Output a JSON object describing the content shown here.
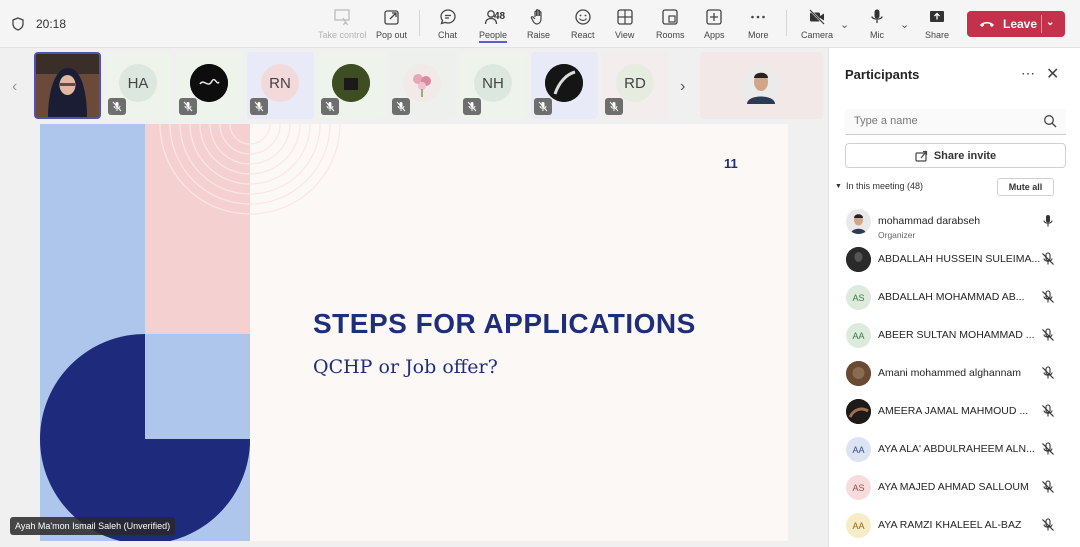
{
  "topbar": {
    "time": "20:18",
    "people_count": "48",
    "buttons": [
      {
        "key": "take_control",
        "label": "Take control"
      },
      {
        "key": "pop_out",
        "label": "Pop out"
      },
      {
        "key": "chat",
        "label": "Chat"
      },
      {
        "key": "people",
        "label": "People"
      },
      {
        "key": "raise",
        "label": "Raise"
      },
      {
        "key": "react",
        "label": "React"
      },
      {
        "key": "view",
        "label": "View"
      },
      {
        "key": "rooms",
        "label": "Rooms"
      },
      {
        "key": "apps",
        "label": "Apps"
      },
      {
        "key": "more",
        "label": "More"
      },
      {
        "key": "camera",
        "label": "Camera"
      },
      {
        "key": "mic",
        "label": "Mic"
      },
      {
        "key": "share",
        "label": "Share"
      }
    ],
    "leave_label": "Leave"
  },
  "strip": {
    "tiles": [
      {
        "initials": "",
        "kind": "video"
      },
      {
        "initials": "HA",
        "kind": "initials"
      },
      {
        "initials": "",
        "kind": "photo"
      },
      {
        "initials": "RN",
        "kind": "initials"
      },
      {
        "initials": "",
        "kind": "photo"
      },
      {
        "initials": "",
        "kind": "photo"
      },
      {
        "initials": "NH",
        "kind": "initials"
      },
      {
        "initials": "",
        "kind": "photo"
      },
      {
        "initials": "RD",
        "kind": "initials"
      }
    ]
  },
  "slide": {
    "number": "11",
    "title": "STEPS FOR APPLICATIONS",
    "subtitle": "QCHP or Job offer?"
  },
  "presenter_tag": "Ayah Ma'mon Ismail Saleh (Unverified)",
  "panel": {
    "title": "Participants",
    "search_placeholder": "Type a name",
    "share_invite": "Share invite",
    "section_label": "In this meeting (48)",
    "mute_all": "Mute all",
    "participants": [
      {
        "name": "mohammad darabseh",
        "role": "Organizer",
        "initials": "",
        "mic": "on"
      },
      {
        "name": "ABDALLAH HUSSEIN SULEIMA...",
        "role": "",
        "initials": "",
        "mic": "muted"
      },
      {
        "name": "ABDALLAH MOHAMMAD AB...",
        "role": "",
        "initials": "AS",
        "mic": "muted"
      },
      {
        "name": "ABEER SULTAN MOHAMMAD ...",
        "role": "",
        "initials": "AA",
        "mic": "muted"
      },
      {
        "name": "Amani mohammed alghannam",
        "role": "",
        "initials": "",
        "mic": "muted"
      },
      {
        "name": "AMEERA JAMAL MAHMOUD ...",
        "role": "",
        "initials": "",
        "mic": "muted"
      },
      {
        "name": "AYA ALA' ABDULRAHEEM ALN...",
        "role": "",
        "initials": "AA",
        "mic": "muted"
      },
      {
        "name": "AYA MAJED AHMAD SALLOUM",
        "role": "",
        "initials": "AS",
        "mic": "muted"
      },
      {
        "name": "AYA RAMZI KHALEEL AL-BAZ",
        "role": "",
        "initials": "AA",
        "mic": "muted"
      }
    ]
  },
  "colors": {
    "accent": "#5b5fc7",
    "leave": "#c4314b",
    "slide_navy": "#1e2e7a",
    "slide_blue": "#aec6ec",
    "slide_pink": "#f5d0d0"
  }
}
